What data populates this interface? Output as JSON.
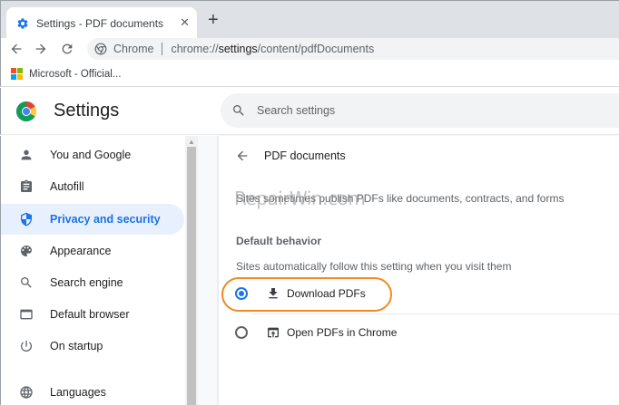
{
  "tab": {
    "title": "Settings - PDF documents",
    "close": "✕",
    "new_tab": "+"
  },
  "omnibox": {
    "chip": "Chrome",
    "url_prefix": "chrome://",
    "url_host": "settings",
    "url_path": "/content/pdfDocuments"
  },
  "bookmarks": [
    {
      "label": "Microsoft - Official..."
    }
  ],
  "settings_header": {
    "title": "Settings",
    "search_placeholder": "Search settings"
  },
  "sidebar": {
    "items": [
      {
        "label": "You and Google",
        "icon": "person-icon"
      },
      {
        "label": "Autofill",
        "icon": "clipboard-icon"
      },
      {
        "label": "Privacy and security",
        "icon": "shield-icon",
        "active": true
      },
      {
        "label": "Appearance",
        "icon": "palette-icon"
      },
      {
        "label": "Search engine",
        "icon": "search-icon"
      },
      {
        "label": "Default browser",
        "icon": "browser-window-icon"
      },
      {
        "label": "On startup",
        "icon": "power-icon"
      },
      {
        "label": "Languages",
        "icon": "globe-icon"
      }
    ]
  },
  "content": {
    "heading": "PDF documents",
    "description": "Sites sometimes publish PDFs like documents, contracts, and forms",
    "watermark": "RepairWin.com",
    "default_behavior_title": "Default behavior",
    "default_behavior_sub": "Sites automatically follow this setting when you visit them",
    "options": [
      {
        "label": "Download PDFs",
        "icon": "download-icon",
        "checked": true
      },
      {
        "label": "Open PDFs in Chrome",
        "icon": "open-in-new-icon",
        "checked": false
      }
    ]
  },
  "colors": {
    "accent": "#1a73e8",
    "highlight": "#f08a24",
    "active_bg": "#e8f0fe"
  }
}
